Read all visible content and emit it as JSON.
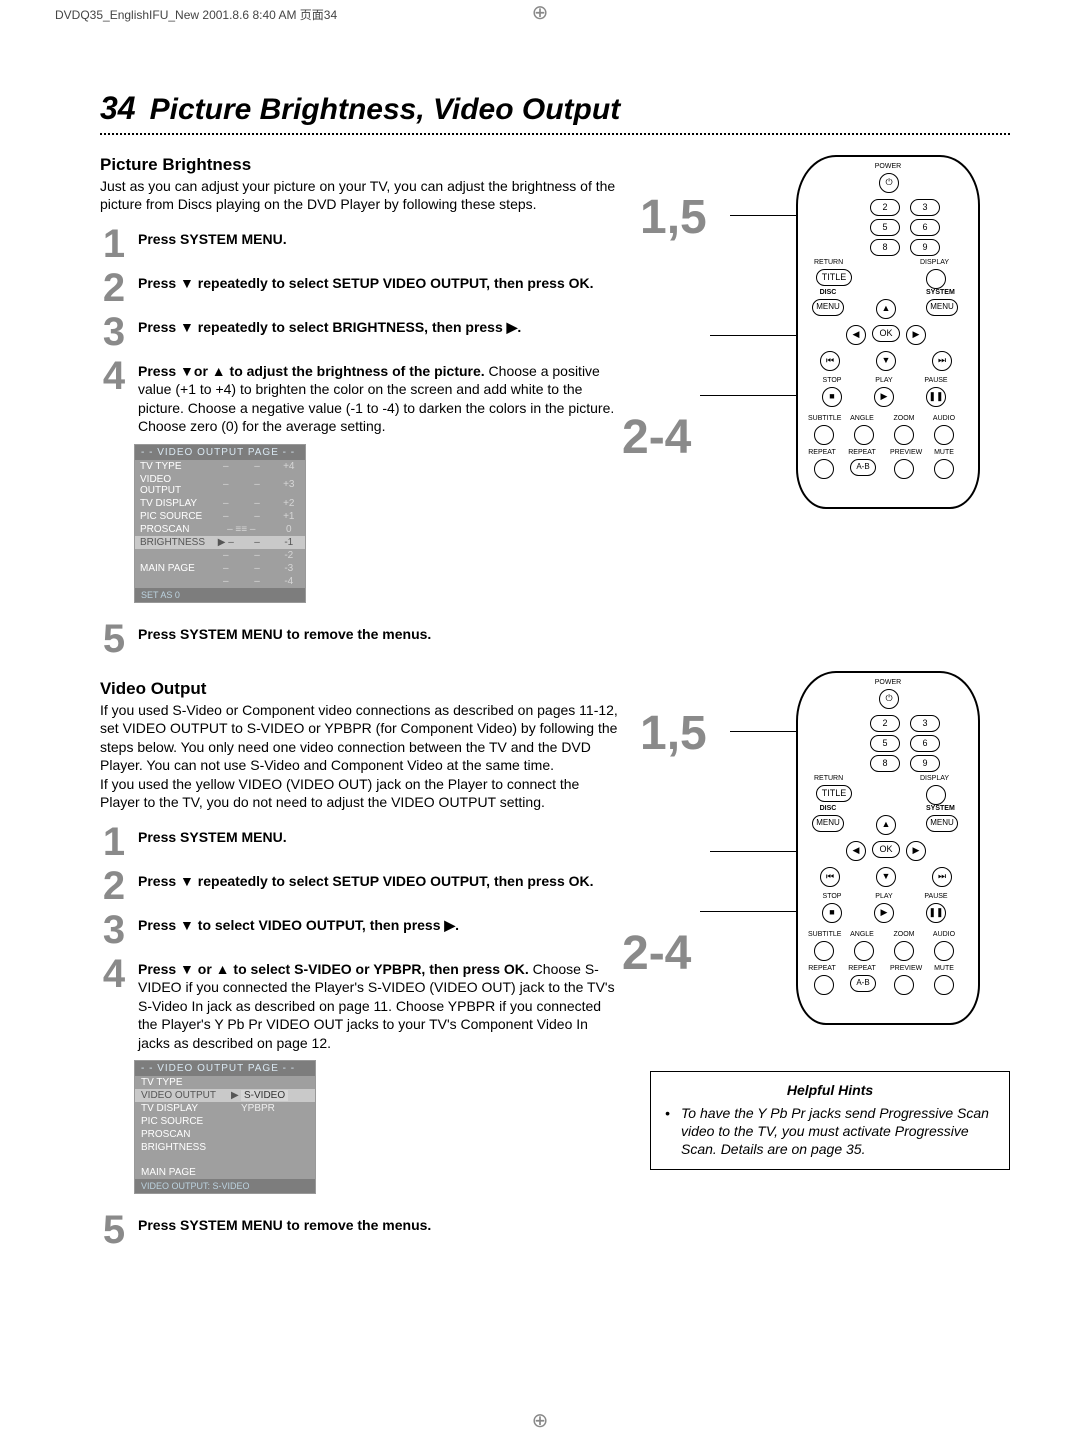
{
  "print_header": "DVDQ35_EnglishIFU_New  2001.8.6 8:40 AM  页面34",
  "page_number": "34",
  "page_title": "Picture Brightness, Video Output",
  "sections": {
    "brightness": {
      "heading": "Picture Brightness",
      "intro": "Just as you can adjust your picture on your TV, you can adjust the brightness of the picture from Discs playing on the DVD Player by following these steps.",
      "steps": [
        {
          "num": "1",
          "bold": "Press SYSTEM MENU.",
          "rest": ""
        },
        {
          "num": "2",
          "bold": "Press ▼ repeatedly to select SETUP VIDEO OUTPUT, then press OK.",
          "rest": ""
        },
        {
          "num": "3",
          "bold": "Press ▼ repeatedly to select BRIGHTNESS, then press ▶.",
          "rest": ""
        },
        {
          "num": "4",
          "bold": "Press ▼or ▲ to adjust the brightness of the picture.",
          "rest": " Choose a positive value (+1 to +4) to brighten the color on the screen and add white to the picture. Choose a negative value (-1 to -4) to darken the colors in the picture. Choose zero (0) for the average setting."
        },
        {
          "num": "5",
          "bold": "Press SYSTEM MENU to remove the menus.",
          "rest": ""
        }
      ]
    },
    "video_output": {
      "heading": "Video Output",
      "intro": "If you used S-Video or Component video connections as described on pages 11-12, set VIDEO OUTPUT to S-VIDEO or YPBPR (for Component Video) by following the steps below. You only need one video connection between the TV and the DVD Player. You can not use S-Video and Component Video at the same time.\nIf you used the yellow VIDEO (VIDEO OUT) jack on the Player to connect the Player to the TV, you do not need to adjust the VIDEO OUTPUT setting.",
      "steps": [
        {
          "num": "1",
          "bold": "Press SYSTEM MENU.",
          "rest": ""
        },
        {
          "num": "2",
          "bold": "Press ▼ repeatedly to select SETUP VIDEO OUTPUT, then press OK.",
          "rest": ""
        },
        {
          "num": "3",
          "bold": "Press ▼ to select VIDEO OUTPUT, then press ▶.",
          "rest": ""
        },
        {
          "num": "4",
          "bold": "Press ▼ or ▲ to select S-VIDEO or YPBPR, then press OK.",
          "rest": " Choose S-VIDEO if you connected the Player's S-VIDEO (VIDEO OUT) jack to the TV's S-Video In jack as described on page 11. Choose YPBPR if you connected the Player's Y Pb Pr VIDEO OUT jacks to your TV's Component Video In jacks as described on page 12."
        },
        {
          "num": "5",
          "bold": "Press SYSTEM MENU to remove the menus.",
          "rest": ""
        }
      ]
    }
  },
  "osd1": {
    "title": "- -  VIDEO OUTPUT PAGE  - -",
    "rows": [
      {
        "label": "TV TYPE",
        "vals": [
          "–",
          "–",
          "+4"
        ]
      },
      {
        "label": "VIDEO OUTPUT",
        "vals": [
          "–",
          "–",
          "+3"
        ]
      },
      {
        "label": "TV DISPLAY",
        "vals": [
          "–",
          "–",
          "+2"
        ]
      },
      {
        "label": "PIC SOURCE",
        "vals": [
          "–",
          "–",
          "+1"
        ]
      },
      {
        "label": "PROSCAN",
        "vals": [
          "– ≡≡ –",
          "",
          "0"
        ]
      },
      {
        "label": "BRIGHTNESS",
        "vals": [
          "▶ –",
          "–",
          "-1"
        ],
        "highlight": true
      },
      {
        "label": "",
        "vals": [
          "–",
          "–",
          "-2"
        ]
      },
      {
        "label": "MAIN PAGE",
        "vals": [
          "–",
          "–",
          "-3"
        ]
      },
      {
        "label": "",
        "vals": [
          "–",
          "–",
          "-4"
        ]
      }
    ],
    "footer": "SET AS 0"
  },
  "osd2": {
    "title": "- -  VIDEO OUTPUT PAGE  - -",
    "rows": [
      {
        "label": "TV TYPE",
        "opt": ""
      },
      {
        "label": "VIDEO OUTPUT",
        "opt": "S-VIDEO",
        "highlight": true,
        "opt_hl": true,
        "prefix": "▶"
      },
      {
        "label": "TV DISPLAY",
        "opt": "YPBPR"
      },
      {
        "label": "PIC SOURCE",
        "opt": ""
      },
      {
        "label": "PROSCAN",
        "opt": ""
      },
      {
        "label": "BRIGHTNESS",
        "opt": ""
      },
      {
        "label": "",
        "opt": ""
      },
      {
        "label": "MAIN PAGE",
        "opt": ""
      }
    ],
    "footer": "VIDEO OUTPUT: S-VIDEO"
  },
  "remote": {
    "callout_top": "1,5",
    "callout_bottom": "2-4",
    "labels": {
      "power": "POWER",
      "return": "RETURN",
      "display": "DISPLAY",
      "title": "TITLE",
      "disc": "DISC",
      "system": "SYSTEM",
      "menu_l": "MENU",
      "menu_r": "MENU",
      "ok": "OK",
      "stop": "STOP",
      "play": "PLAY",
      "pause": "PAUSE",
      "subtitle": "SUBTITLE",
      "angle": "ANGLE",
      "zoom": "ZOOM",
      "audio": "AUDIO",
      "repeat": "REPEAT",
      "repeat2": "REPEAT",
      "preview": "PREVIEW",
      "mute": "MUTE",
      "ab": "A-B"
    },
    "digits": [
      "2",
      "3",
      "5",
      "6",
      "8",
      "9"
    ]
  },
  "hints": {
    "title": "Helpful Hints",
    "items": [
      "To have the Y Pb Pr jacks send Progressive Scan video to the TV, you must activate Progressive Scan. Details are on page 35."
    ]
  }
}
